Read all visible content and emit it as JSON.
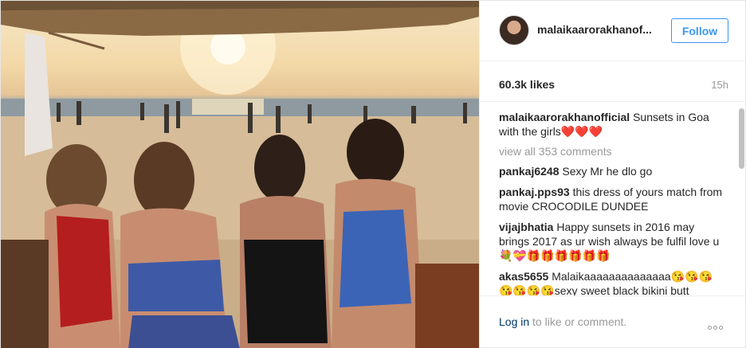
{
  "post": {
    "photo_alt": "",
    "header": {
      "username": "malaikaarorakhanof...",
      "follow_label": "Follow"
    },
    "likes": "60.3k likes",
    "timestamp": "15h",
    "caption": {
      "author": "malaikaarorakhanofficial",
      "text": "Sunsets in Goa with the girls❤️❤️❤️"
    },
    "view_all_label": "view all 353 comments",
    "comments": [
      {
        "author": "pankaj6248",
        "text": "Sexy Mr he dlo go"
      },
      {
        "author": "pankaj.pps93",
        "text": "this dress of yours match from movie CROCODILE DUNDEE"
      },
      {
        "author": "vijajbhatia",
        "text": "Happy sunsets in 2016 may brings 2017 as ur wish always be fulfil love u💐💝🎁🎁🎁🎁🎁🎁"
      },
      {
        "author": "akas5655",
        "text": "Malaikaaaaaaaaaaaaaa😘😘😘😘😘😘😘sexy sweet black bikini butt"
      }
    ],
    "footer": {
      "login_link": "Log in",
      "login_rest": " to like or comment."
    },
    "colors": {
      "accent": "#3897f0",
      "link": "#003569",
      "muted": "#999999"
    }
  }
}
